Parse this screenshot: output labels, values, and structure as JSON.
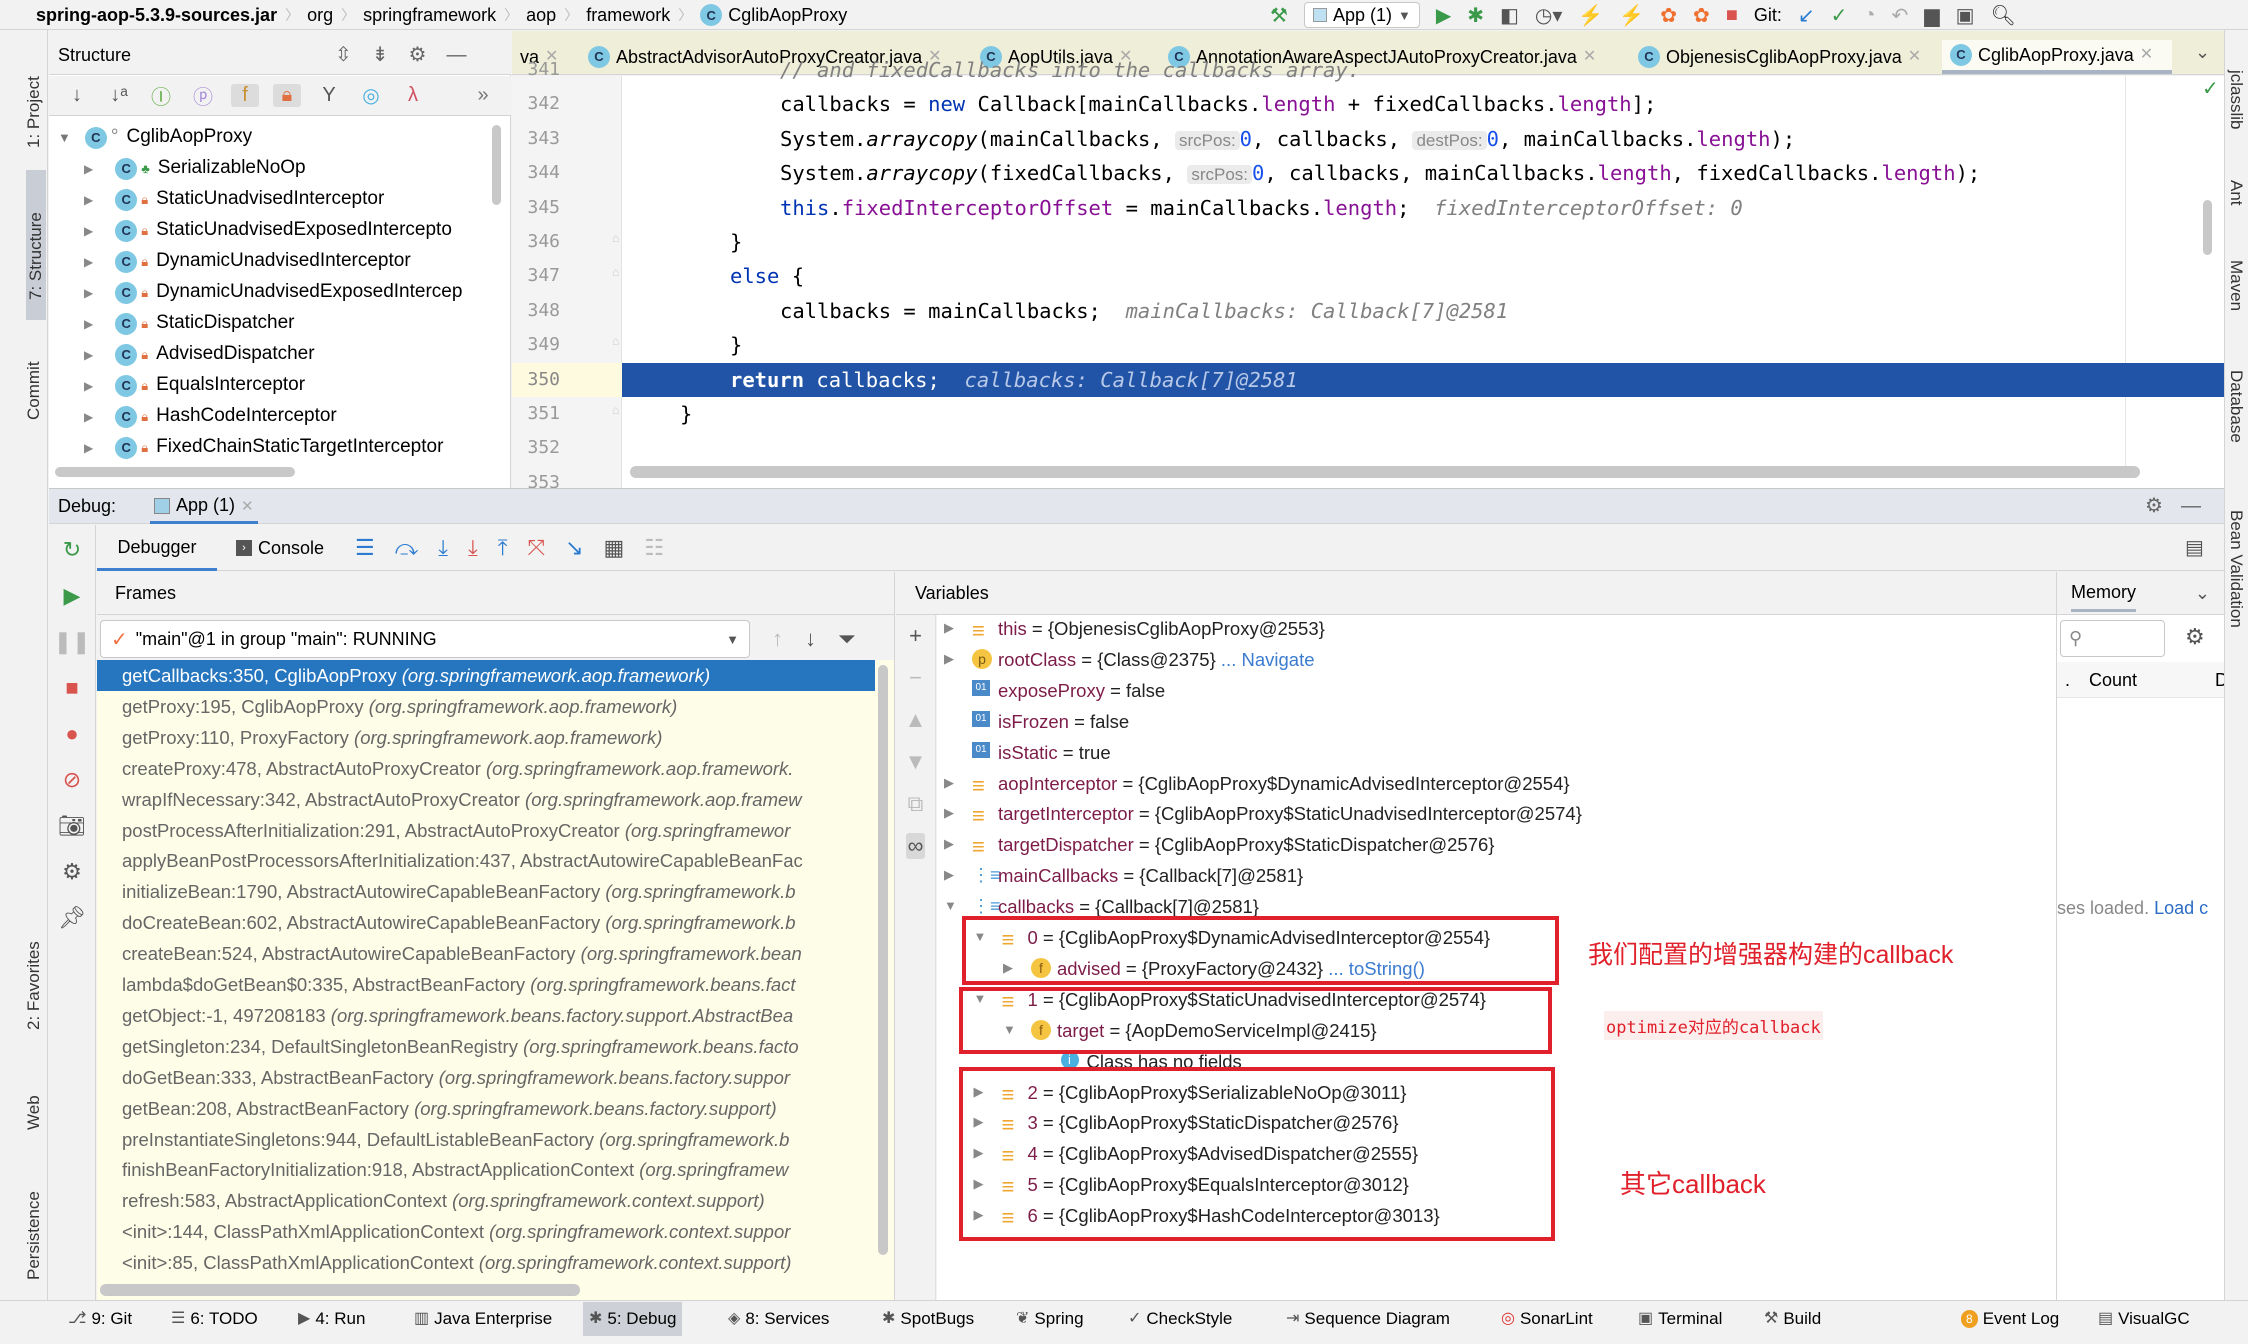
{
  "breadcrumb": [
    "spring-aop-5.3.9-sources.jar",
    "org",
    "springframework",
    "aop",
    "framework",
    "CglibAopProxy"
  ],
  "toolbar": {
    "run_config": "App (1)",
    "git_label": "Git:"
  },
  "left_strip": [
    "1: Project",
    "7: Structure",
    "Commit",
    "2: Favorites",
    "Web",
    "Persistence"
  ],
  "right_strip": [
    "jclasslib",
    "Ant",
    "Maven",
    "Database",
    "Bean Validation"
  ],
  "structure": {
    "title": "Structure",
    "root": "CglibAopProxy",
    "items": [
      "SerializableNoOp",
      "StaticUnadvisedInterceptor",
      "StaticUnadvisedExposedIntercepto",
      "DynamicUnadvisedInterceptor",
      "DynamicUnadvisedExposedIntercep",
      "StaticDispatcher",
      "AdvisedDispatcher",
      "EqualsInterceptor",
      "HashCodeInterceptor",
      "FixedChainStaticTargetInterceptor"
    ],
    "toolbar_icons": [
      "sort-visibility-icon",
      "sort-alpha-icon",
      "inherited-icon",
      "properties-icon",
      "fields-icon",
      "non-public-icon",
      "filter-icon",
      "anonymous-icon",
      "lambda-icon",
      "more-icon"
    ]
  },
  "editor": {
    "tabs": [
      {
        "label": "va",
        "active": false
      },
      {
        "label": "AbstractAdvisorAutoProxyCreator.java",
        "active": false
      },
      {
        "label": "AopUtils.java",
        "active": false
      },
      {
        "label": "AnnotationAwareAspectJAutoProxyCreator.java",
        "active": false
      },
      {
        "label": "ObjenesisCglibAopProxy.java",
        "active": false
      },
      {
        "label": "CglibAopProxy.java",
        "active": true
      }
    ],
    "current_line": 350,
    "lines": [
      {
        "n": "341",
        "indent": 4,
        "tokens": [
          [
            "hint",
            "// and fixedCallbacks into the callbacks array."
          ]
        ]
      },
      {
        "n": "342",
        "indent": 4,
        "tokens": [
          [
            "",
            "callbacks = "
          ],
          [
            "kw",
            "new"
          ],
          [
            "",
            " Callback[mainCallbacks."
          ],
          [
            "fld",
            "length"
          ],
          [
            "",
            " + fixedCallbacks."
          ],
          [
            "fld",
            "length"
          ],
          [
            "",
            "];"
          ]
        ]
      },
      {
        "n": "343",
        "indent": 4,
        "tokens": [
          [
            "",
            "System."
          ],
          [
            "it",
            "arraycopy"
          ],
          [
            "",
            "(mainCallbacks, "
          ],
          [
            "param",
            "srcPos:"
          ],
          [
            "num",
            "0"
          ],
          [
            "",
            ", callbacks, "
          ],
          [
            "param",
            "destPos:"
          ],
          [
            "num",
            "0"
          ],
          [
            "",
            ", mainCallbacks."
          ],
          [
            "fld",
            "length"
          ],
          [
            "",
            ");"
          ]
        ]
      },
      {
        "n": "344",
        "indent": 4,
        "tokens": [
          [
            "",
            "System."
          ],
          [
            "it",
            "arraycopy"
          ],
          [
            "",
            "(fixedCallbacks, "
          ],
          [
            "param",
            "srcPos:"
          ],
          [
            "num",
            "0"
          ],
          [
            "",
            ", callbacks, mainCallbacks."
          ],
          [
            "fld",
            "length"
          ],
          [
            "",
            ", fixedCallbacks."
          ],
          [
            "fld",
            "length"
          ],
          [
            "",
            ");"
          ]
        ]
      },
      {
        "n": "345",
        "indent": 4,
        "tokens": [
          [
            "kw",
            "this"
          ],
          [
            "",
            "."
          ],
          [
            "fld",
            "fixedInterceptorOffset"
          ],
          [
            "",
            " = mainCallbacks."
          ],
          [
            "fld",
            "length"
          ],
          [
            "",
            ";  "
          ],
          [
            "hint",
            "fixedInterceptorOffset: 0"
          ]
        ]
      },
      {
        "n": "346",
        "indent": 3,
        "tokens": [
          [
            "",
            "}"
          ]
        ]
      },
      {
        "n": "347",
        "indent": 3,
        "tokens": [
          [
            "kw",
            "else"
          ],
          [
            "",
            " {"
          ]
        ]
      },
      {
        "n": "348",
        "indent": 4,
        "tokens": [
          [
            "",
            "callbacks = mainCallbacks;  "
          ],
          [
            "hint",
            "mainCallbacks: Callback[7]@2581"
          ]
        ]
      },
      {
        "n": "349",
        "indent": 3,
        "tokens": [
          [
            "",
            "}"
          ]
        ]
      },
      {
        "n": "350",
        "indent": 3,
        "tokens": [
          [
            "kw",
            "return"
          ],
          [
            "",
            " callbacks;  "
          ],
          [
            "hint",
            "callbacks: Callback[7]@2581"
          ]
        ]
      },
      {
        "n": "351",
        "indent": 2,
        "tokens": [
          [
            "",
            "}"
          ]
        ]
      },
      {
        "n": "352",
        "indent": 0,
        "tokens": []
      },
      {
        "n": "353",
        "indent": 0,
        "tokens": []
      }
    ]
  },
  "debug": {
    "label": "Debug:",
    "session_tab": "App (1)",
    "tabs": [
      "Debugger",
      "Console"
    ],
    "frames_title": "Frames",
    "thread": "\"main\"@1 in group \"main\": RUNNING",
    "frames": [
      [
        "getCallbacks:350, CglibAopProxy",
        "(org.springframework.aop.framework)"
      ],
      [
        "getProxy:195, CglibAopProxy",
        "(org.springframework.aop.framework)"
      ],
      [
        "getProxy:110, ProxyFactory",
        "(org.springframework.aop.framework)"
      ],
      [
        "createProxy:478, AbstractAutoProxyCreator",
        "(org.springframework.aop.framework."
      ],
      [
        "wrapIfNecessary:342, AbstractAutoProxyCreator",
        "(org.springframework.aop.framew"
      ],
      [
        "postProcessAfterInitialization:291, AbstractAutoProxyCreator",
        "(org.springframewor"
      ],
      [
        "applyBeanPostProcessorsAfterInitialization:437, AbstractAutowireCapableBeanFac",
        ""
      ],
      [
        "initializeBean:1790, AbstractAutowireCapableBeanFactory",
        "(org.springframework.b"
      ],
      [
        "doCreateBean:602, AbstractAutowireCapableBeanFactory",
        "(org.springframework.b"
      ],
      [
        "createBean:524, AbstractAutowireCapableBeanFactory",
        "(org.springframework.bean"
      ],
      [
        "lambda$doGetBean$0:335, AbstractBeanFactory",
        "(org.springframework.beans.fact"
      ],
      [
        "getObject:-1, 497208183",
        "(org.springframework.beans.factory.support.AbstractBea"
      ],
      [
        "getSingleton:234, DefaultSingletonBeanRegistry",
        "(org.springframework.beans.facto"
      ],
      [
        "doGetBean:333, AbstractBeanFactory",
        "(org.springframework.beans.factory.suppor"
      ],
      [
        "getBean:208, AbstractBeanFactory",
        "(org.springframework.beans.factory.support)"
      ],
      [
        "preInstantiateSingletons:944, DefaultListableBeanFactory",
        "(org.springframework.b"
      ],
      [
        "finishBeanFactoryInitialization:918, AbstractApplicationContext",
        "(org.springframew"
      ],
      [
        "refresh:583, AbstractApplicationContext",
        "(org.springframework.context.support)"
      ],
      [
        "<init>:144, ClassPathXmlApplicationContext",
        "(org.springframework.context.suppor"
      ],
      [
        "<init>:85, ClassPathXmlApplicationContext",
        "(org.springframework.context.support)"
      ]
    ],
    "variables_title": "Variables",
    "variables": [
      {
        "lvl": 0,
        "arrow": "right",
        "icon": "object",
        "name": "this",
        "value": " = {ObjenesisCglibAopProxy@2553}"
      },
      {
        "lvl": 0,
        "arrow": "right",
        "icon": "p",
        "name": "rootClass",
        "value": " = {Class@2375}",
        "link": " ... Navigate"
      },
      {
        "lvl": 0,
        "arrow": "",
        "icon": "01",
        "name": "exposeProxy",
        "value": " = false"
      },
      {
        "lvl": 0,
        "arrow": "",
        "icon": "01",
        "name": "isFrozen",
        "value": " = false"
      },
      {
        "lvl": 0,
        "arrow": "",
        "icon": "01",
        "name": "isStatic",
        "value": " = true"
      },
      {
        "lvl": 0,
        "arrow": "right",
        "icon": "object",
        "name": "aopInterceptor",
        "value": " = {CglibAopProxy$DynamicAdvisedInterceptor@2554}"
      },
      {
        "lvl": 0,
        "arrow": "right",
        "icon": "object",
        "name": "targetInterceptor",
        "value": " = {CglibAopProxy$StaticUnadvisedInterceptor@2574}"
      },
      {
        "lvl": 0,
        "arrow": "right",
        "icon": "object",
        "name": "targetDispatcher",
        "value": " = {CglibAopProxy$StaticDispatcher@2576}"
      },
      {
        "lvl": 0,
        "arrow": "right",
        "icon": "array",
        "name": "mainCallbacks",
        "value": " = {Callback[7]@2581}"
      },
      {
        "lvl": 0,
        "arrow": "down",
        "icon": "array",
        "name": "callbacks",
        "value": " = {Callback[7]@2581}"
      },
      {
        "lvl": 1,
        "arrow": "down",
        "icon": "object",
        "name": "0",
        "value": " = {CglibAopProxy$DynamicAdvisedInterceptor@2554}"
      },
      {
        "lvl": 2,
        "arrow": "right",
        "icon": "f",
        "name": "advised",
        "value": " = {ProxyFactory@2432}",
        "link": " ... toString()"
      },
      {
        "lvl": 1,
        "arrow": "down",
        "icon": "object",
        "name": "1",
        "value": " = {CglibAopProxy$StaticUnadvisedInterceptor@2574}"
      },
      {
        "lvl": 2,
        "arrow": "down",
        "icon": "f",
        "name": "target",
        "value": " = {AopDemoServiceImpl@2415}"
      },
      {
        "lvl": 3,
        "arrow": "",
        "icon": "info",
        "name": "",
        "value": "Class has no fields"
      },
      {
        "lvl": 1,
        "arrow": "right",
        "icon": "object",
        "name": "2",
        "value": " = {CglibAopProxy$SerializableNoOp@3011}"
      },
      {
        "lvl": 1,
        "arrow": "right",
        "icon": "object",
        "name": "3",
        "value": " = {CglibAopProxy$StaticDispatcher@2576}"
      },
      {
        "lvl": 1,
        "arrow": "right",
        "icon": "object",
        "name": "4",
        "value": " = {CglibAopProxy$AdvisedDispatcher@2555}"
      },
      {
        "lvl": 1,
        "arrow": "right",
        "icon": "object",
        "name": "5",
        "value": " = {CglibAopProxy$EqualsInterceptor@3012}"
      },
      {
        "lvl": 1,
        "arrow": "right",
        "icon": "object",
        "name": "6",
        "value": " = {CglibAopProxy$HashCodeInterceptor@3013}"
      }
    ],
    "memory": {
      "title": "Memory",
      "column": "Count",
      "column_next": "D",
      "status": "ses loaded. ",
      "status_link": "Load c"
    }
  },
  "annotations": {
    "box1": "我们配置的增强器构建的callback",
    "box2": "optimize对应的callback",
    "box3": "其它callback",
    "color": "#e0202a"
  },
  "bottom_bar": [
    {
      "label": "9: Git",
      "icon": "git-icon"
    },
    {
      "label": "6: TODO",
      "icon": "todo-icon"
    },
    {
      "label": "4: Run",
      "icon": "run-icon"
    },
    {
      "label": "Java Enterprise",
      "icon": "java-enterprise-icon"
    },
    {
      "label": "5: Debug",
      "icon": "debug-icon",
      "active": true
    },
    {
      "label": "8: Services",
      "icon": "services-icon"
    },
    {
      "label": "SpotBugs",
      "icon": "spotbugs-icon"
    },
    {
      "label": "Spring",
      "icon": "spring-icon"
    },
    {
      "label": "CheckStyle",
      "icon": "checkstyle-icon"
    },
    {
      "label": "Sequence Diagram",
      "icon": "sequence-diagram-icon"
    },
    {
      "label": "SonarLint",
      "icon": "sonarlint-icon"
    },
    {
      "label": "Terminal",
      "icon": "terminal-icon"
    },
    {
      "label": "Build",
      "icon": "build-icon"
    },
    {
      "label": "Event Log",
      "icon": "event-log-icon",
      "badge": "8"
    },
    {
      "label": "VisualGC",
      "icon": "visualgc-icon"
    }
  ],
  "colors": {
    "selection": "#2675bf",
    "current_line": "#2154a6",
    "frames_bg": "#fdfde8",
    "accent": "#3b7bd0"
  }
}
